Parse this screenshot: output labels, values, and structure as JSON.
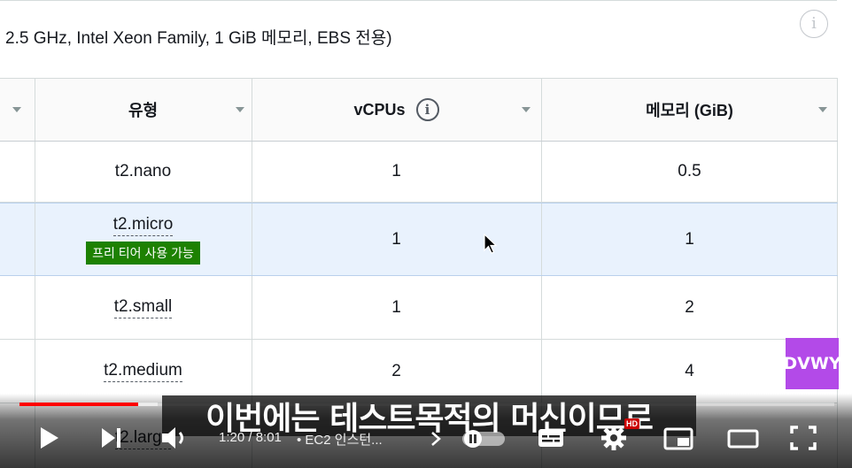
{
  "description": "2.5 GHz, Intel Xeon Family, 1 GiB 메모리, EBS 전용)",
  "info_glyph": "i",
  "table": {
    "headers": {
      "type": "유형",
      "vcpus": "vCPUs",
      "memory": "메모리 (GiB)"
    },
    "rows": [
      {
        "type": "t2.nano",
        "vcpus": "1",
        "memory": "0.5",
        "badge": ""
      },
      {
        "type": "t2.micro",
        "vcpus": "1",
        "memory": "1",
        "badge": "프리 티어 사용 가능"
      },
      {
        "type": "t2.small",
        "vcpus": "1",
        "memory": "2",
        "badge": ""
      },
      {
        "type": "t2.medium",
        "vcpus": "2",
        "memory": "4",
        "badge": ""
      },
      {
        "type": "t2.large",
        "vcpus": "",
        "memory": "",
        "badge": ""
      }
    ]
  },
  "watermark": "DVWY",
  "player": {
    "subtitle": "이번에는 테스트목적의 머신이므로",
    "time": "1:20 / 8:01",
    "chapter": "• EC2 인스턴...",
    "hd_badge": "HD",
    "progress": 0.146,
    "buffered": 0.17,
    "accent": "#ff0000"
  },
  "colors": {
    "selected_row": "#e9f2fd",
    "badge_green": "#1d8102",
    "watermark_purple": "#b34ae8"
  }
}
